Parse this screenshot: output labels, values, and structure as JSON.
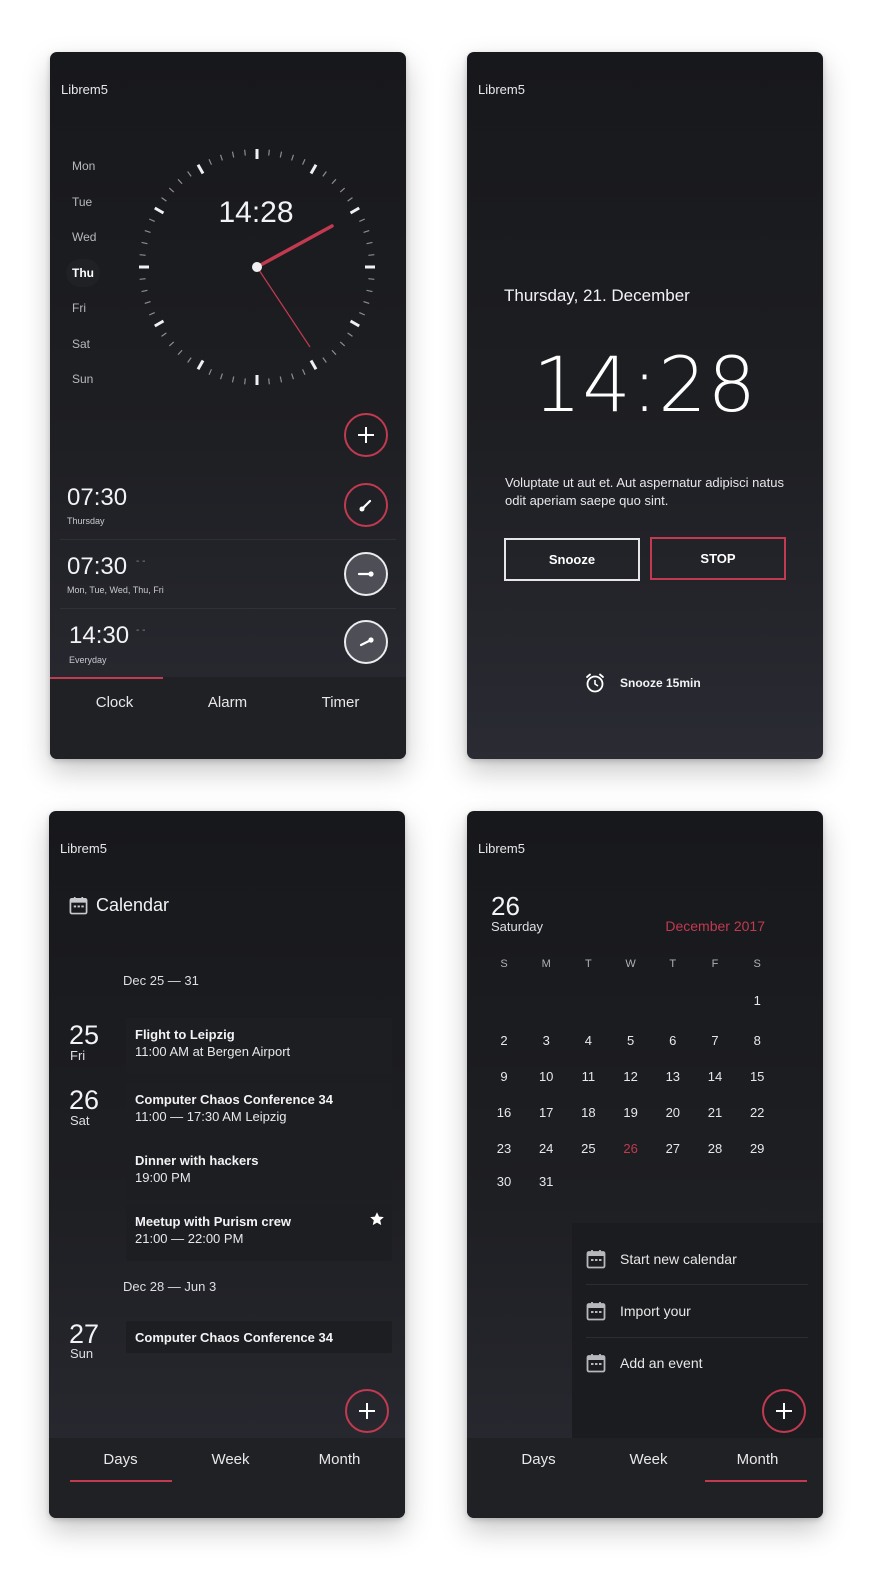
{
  "clock_screen": {
    "brand": "Librem5",
    "weekdays": [
      "Mon",
      "Tue",
      "Wed",
      "Thu",
      "Fri",
      "Sat",
      "Sun"
    ],
    "active_weekday": "Thu",
    "clock_time": "14:28",
    "alarms": [
      {
        "time": "07:30",
        "days": "Thursday",
        "enabled": true
      },
      {
        "time": "07:30",
        "days": "Mon, Tue, Wed, Thu, Fri",
        "enabled": false
      },
      {
        "time": "14:30",
        "days": "Everyday",
        "enabled": false
      }
    ],
    "alarm_dash": "- -",
    "tabs": [
      "Clock",
      "Alarm",
      "Timer"
    ],
    "active_tab": "Clock"
  },
  "alarm_screen": {
    "brand": "Librem5",
    "date": "Thursday, 21. December",
    "time": "14:28",
    "message": "Voluptate ut aut et. Aut aspernatur adipisci natus odit aperiam saepe quo sint.",
    "snooze_label": "Snooze",
    "stop_label": "STOP",
    "snooze_15_label": "Snooze 15min"
  },
  "calendar_days": {
    "brand": "Librem5",
    "title": "Calendar",
    "ranges": [
      "Dec 25 — 31",
      "Dec 28 — Jun 3"
    ],
    "days": [
      {
        "num": "25",
        "name": "Fri"
      },
      {
        "num": "26",
        "name": "Sat"
      },
      {
        "num": "27",
        "name": "Sun"
      }
    ],
    "events": [
      {
        "title": "Flight to Leipzig",
        "sub": "11:00 AM at Bergen Airport"
      },
      {
        "title": "Computer Chaos Conference 34",
        "sub": "11:00 — 17:30 AM Leipzig"
      },
      {
        "title": "Dinner with hackers",
        "sub": "19:00 PM"
      },
      {
        "title": "Meetup with Purism crew",
        "sub": "21:00 — 22:00 PM",
        "starred": true
      },
      {
        "title": "Computer Chaos Conference 34",
        "sub": ""
      }
    ],
    "tabs": [
      "Days",
      "Week",
      "Month"
    ],
    "active_tab": "Days"
  },
  "calendar_month": {
    "brand": "Librem5",
    "selected_day": "26",
    "selected_dayname": "Saturday",
    "month_title": "December 2017",
    "weekday_initials": [
      "S",
      "M",
      "T",
      "W",
      "T",
      "F",
      "S"
    ],
    "weeks": [
      [
        "",
        "",
        "",
        "",
        "",
        "",
        "1"
      ],
      [
        "2",
        "3",
        "4",
        "5",
        "6",
        "7",
        "8"
      ],
      [
        "9",
        "10",
        "11",
        "12",
        "13",
        "14",
        "15"
      ],
      [
        "16",
        "17",
        "18",
        "19",
        "20",
        "21",
        "22"
      ],
      [
        "23",
        "24",
        "25",
        "26",
        "27",
        "28",
        "29"
      ],
      [
        "30",
        "31",
        "",
        "",
        "",
        "",
        ""
      ]
    ],
    "today": "26",
    "menu": [
      "Start new calendar",
      "Import your",
      "Add an event"
    ],
    "tabs": [
      "Days",
      "Week",
      "Month"
    ],
    "active_tab": "Month"
  },
  "colors": {
    "accent": "#c13a50",
    "background": "#1e1f23",
    "tabbar": "#202124"
  }
}
